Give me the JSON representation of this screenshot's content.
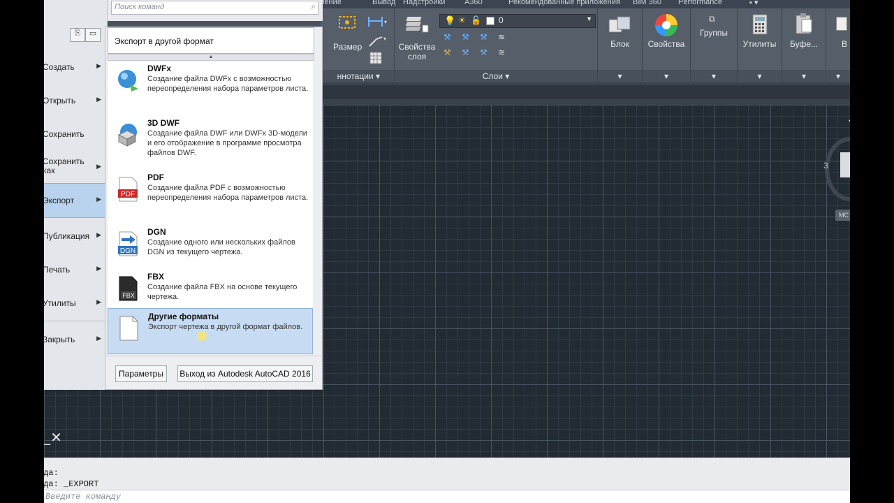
{
  "ribbon": {
    "tabs": [
      "ление",
      "Вывод",
      "Надстройки",
      "А360",
      "Рекомендованные приложения",
      "BIM 360",
      "Performance"
    ],
    "razmer_label": "Размер",
    "annotations_label": "ннотации",
    "layer_props_label": "Свойства слоя",
    "layer_value": "0",
    "layers_label": "Слои",
    "block_label": "Блок",
    "properties_label": "Свойства",
    "groups_label": "Группы",
    "utilities_label": "Утилиты",
    "buffer_label": "Буфе...",
    "cut_label": "В"
  },
  "search": {
    "placeholder": "Поиск команд"
  },
  "left_menu": {
    "items": [
      {
        "label": "Создать"
      },
      {
        "label": "Открыть"
      },
      {
        "label": "Сохранить"
      },
      {
        "label": "Сохранить как"
      },
      {
        "label": "Экспорт"
      },
      {
        "label": "Публикация"
      },
      {
        "label": "Печать"
      },
      {
        "label": "Утилиты"
      },
      {
        "label": "Закрыть"
      }
    ]
  },
  "submenu": {
    "title": "Экспорт в другой формат",
    "items": [
      {
        "title": "DWFx",
        "desc": "Создание файла DWFx с возможностью переопределения набора параметров листа.",
        "icon": "dwfx-icon"
      },
      {
        "title": "3D DWF",
        "desc": "Создание файла DWF или DWFx 3D-модели и его отображение в программе просмотра файлов DWF.",
        "icon": "3d-dwf-icon"
      },
      {
        "title": "PDF",
        "desc": "Создание файла PDF с возможностью переопределения набора параметров листа.",
        "icon": "pdf-icon"
      },
      {
        "title": "DGN",
        "desc": "Создание одного или нескольких файлов DGN из текущего чертежа.",
        "icon": "dgn-icon"
      },
      {
        "title": "FBX",
        "desc": "Создание файла FBX на основе текущего чертежа.",
        "icon": "fbx-icon"
      },
      {
        "title": "Другие форматы",
        "desc": "Экспорт чертежа в другой формат файлов.",
        "icon": "other-file-icon"
      }
    ],
    "params_button": "Параметры",
    "exit_button": "Выход из Autodesk AutoCAD 2016"
  },
  "command": {
    "line1": "нда:",
    "line2": "нда: _EXPORT",
    "placeholder": "Введите команду"
  },
  "viewcube": {
    "label": "МС",
    "num": "3"
  },
  "colors": {
    "accent": "#b9d3ee",
    "pdf_red": "#cc2a2a",
    "dgn_blue": "#2f74c0"
  }
}
